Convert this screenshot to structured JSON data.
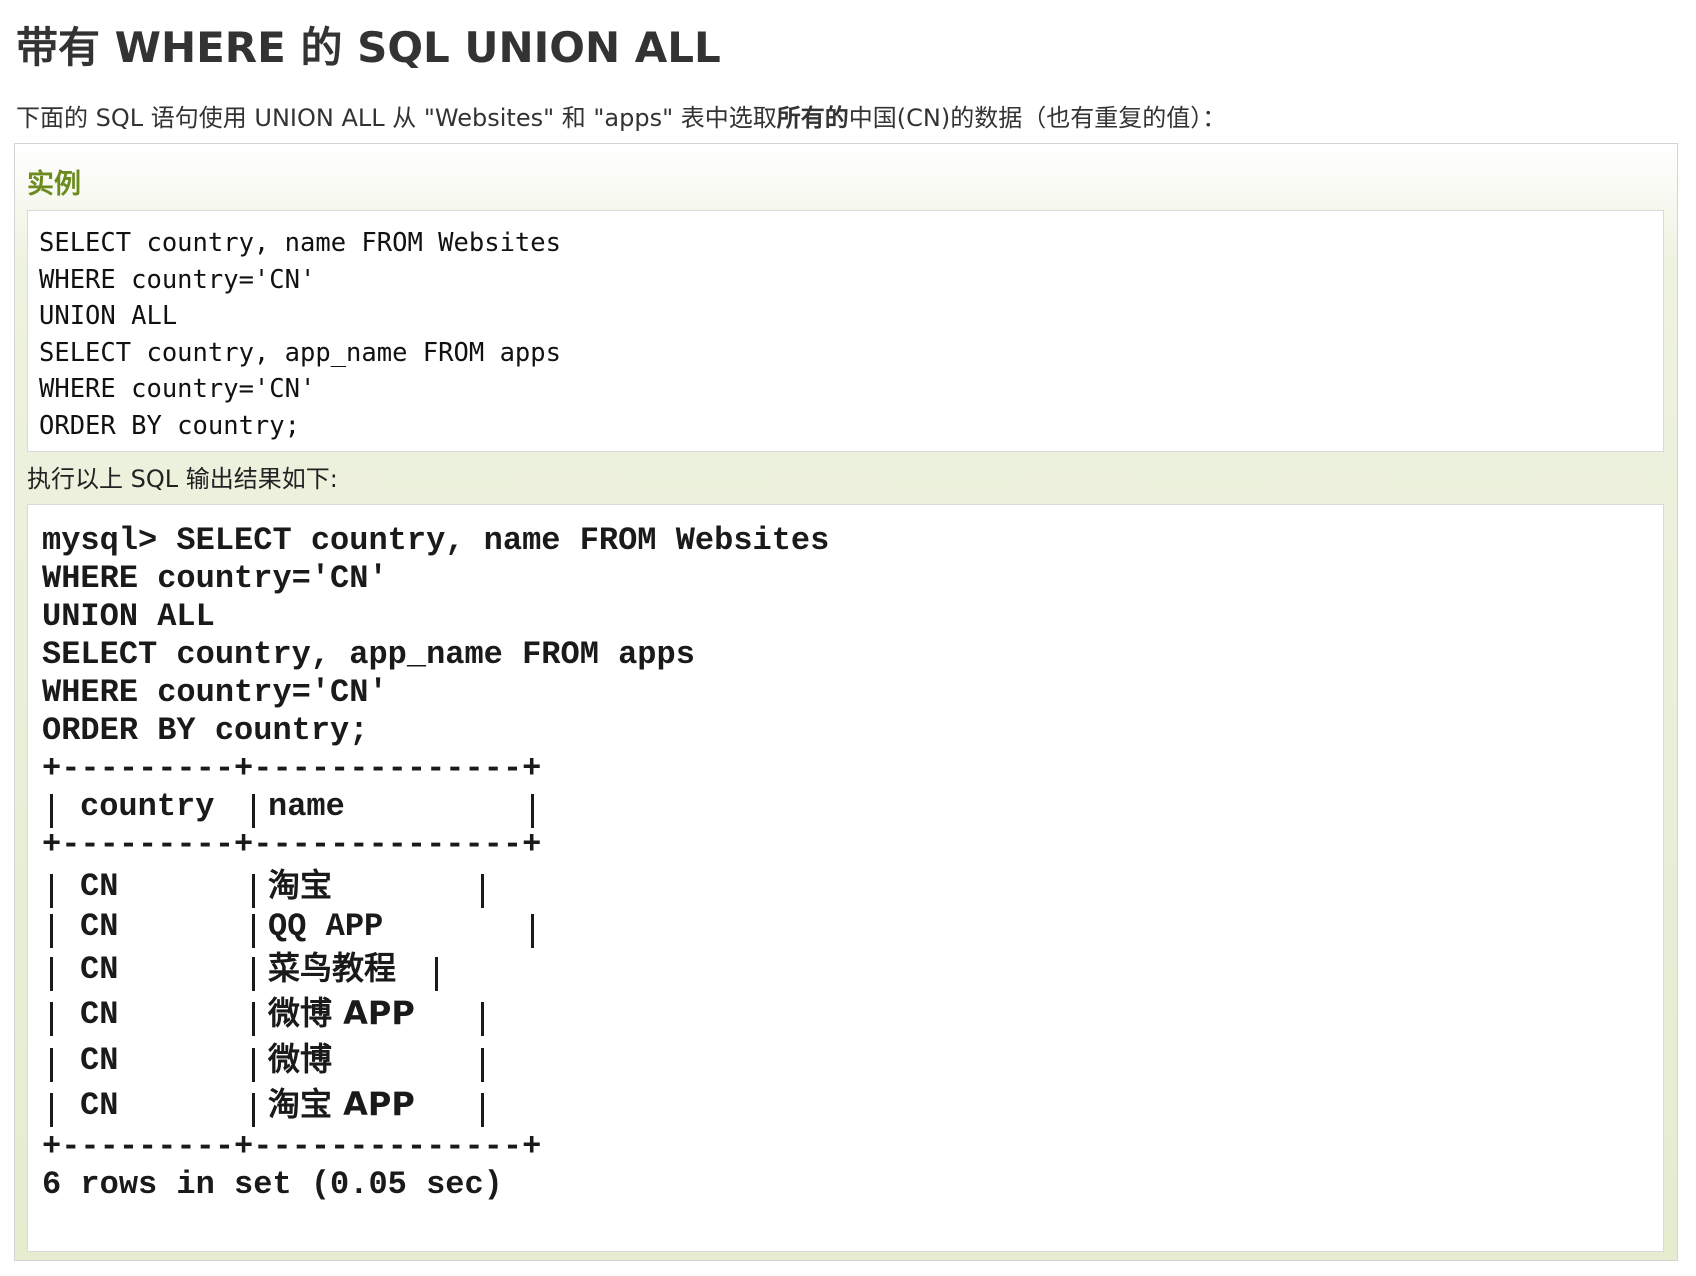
{
  "page": {
    "title": "带有 WHERE 的 SQL UNION ALL",
    "intro_before": "下面的 SQL 语句使用 UNION ALL 从 \"Websites\" 和 \"apps\" 表中选取",
    "intro_bold": "所有的",
    "intro_after": "中国(CN)的数据（也有重复的值）："
  },
  "example": {
    "title": "实例",
    "code_lines": [
      "SELECT country, name FROM Websites",
      "WHERE country='CN'",
      "UNION ALL",
      "SELECT country, app_name FROM apps",
      "WHERE country='CN'",
      "ORDER BY country;"
    ],
    "result_label": "执行以上 SQL 输出结果如下:",
    "output": {
      "query_lines": [
        "mysql> SELECT country, name FROM Websites",
        "WHERE country='CN'",
        "UNION ALL",
        "SELECT country, app_name FROM apps",
        "WHERE country='CN'",
        "ORDER BY country;"
      ],
      "border_top": "+---------+--------------+",
      "border_mid": "+---------+--------------+",
      "border_bottom": "+---------+--------------+",
      "headers": [
        "country",
        "name"
      ],
      "rows": [
        {
          "country": "CN",
          "name": "淘宝"
        },
        {
          "country": "CN",
          "name": "QQ APP"
        },
        {
          "country": "CN",
          "name": "菜鸟教程"
        },
        {
          "country": "CN",
          "name": "微博 APP"
        },
        {
          "country": "CN",
          "name": "微博"
        },
        {
          "country": "CN",
          "name": "淘宝 APP"
        }
      ],
      "footer": "6 rows in set (0.05 sec)"
    }
  }
}
